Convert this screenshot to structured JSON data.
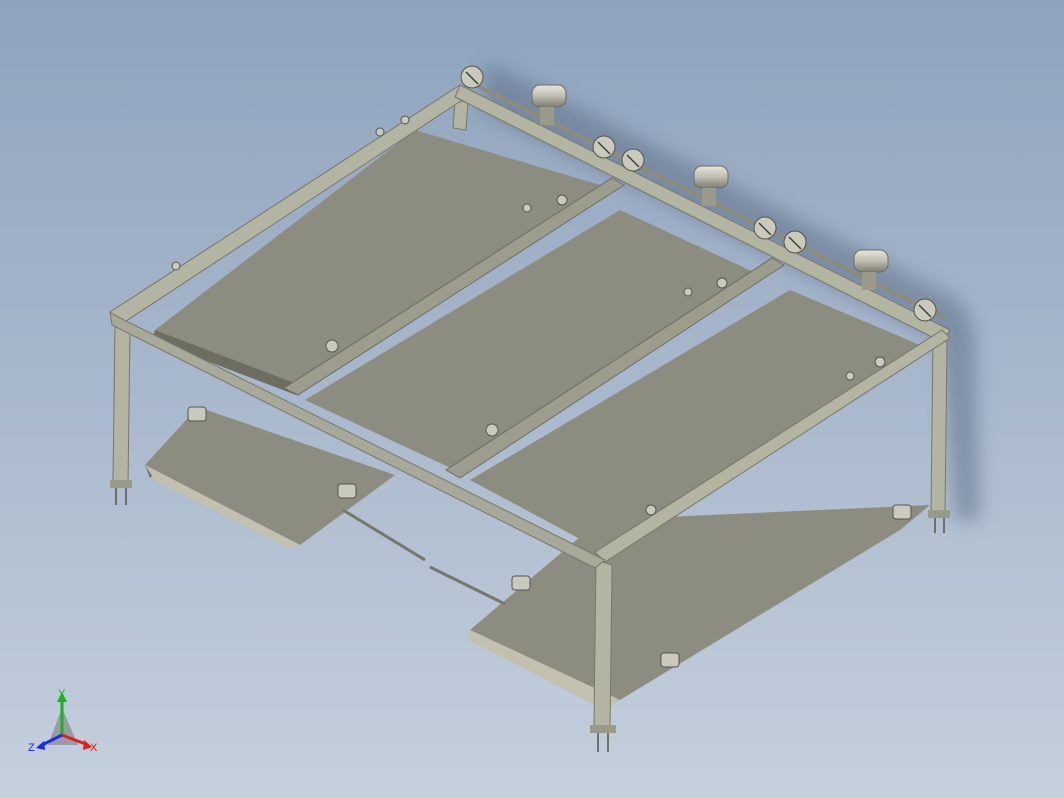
{
  "viewport": {
    "background_top": "#8ea3bd",
    "background_bottom": "#c5d0dd"
  },
  "model": {
    "panel_color": "#8d8c80",
    "panel_dark": "#6e6d62",
    "panel_light": "#a9a89a",
    "frame_color": "#b4b4a2",
    "frame_dark": "#77776a",
    "motor_color": "#c9c9bd",
    "shadow_color": "#5f6f88"
  },
  "triad": {
    "x_label": "X",
    "y_label": "Y",
    "z_label": "Z",
    "x_color": "#e0201b",
    "y_color": "#18b41a",
    "z_color": "#1b2ee0"
  }
}
